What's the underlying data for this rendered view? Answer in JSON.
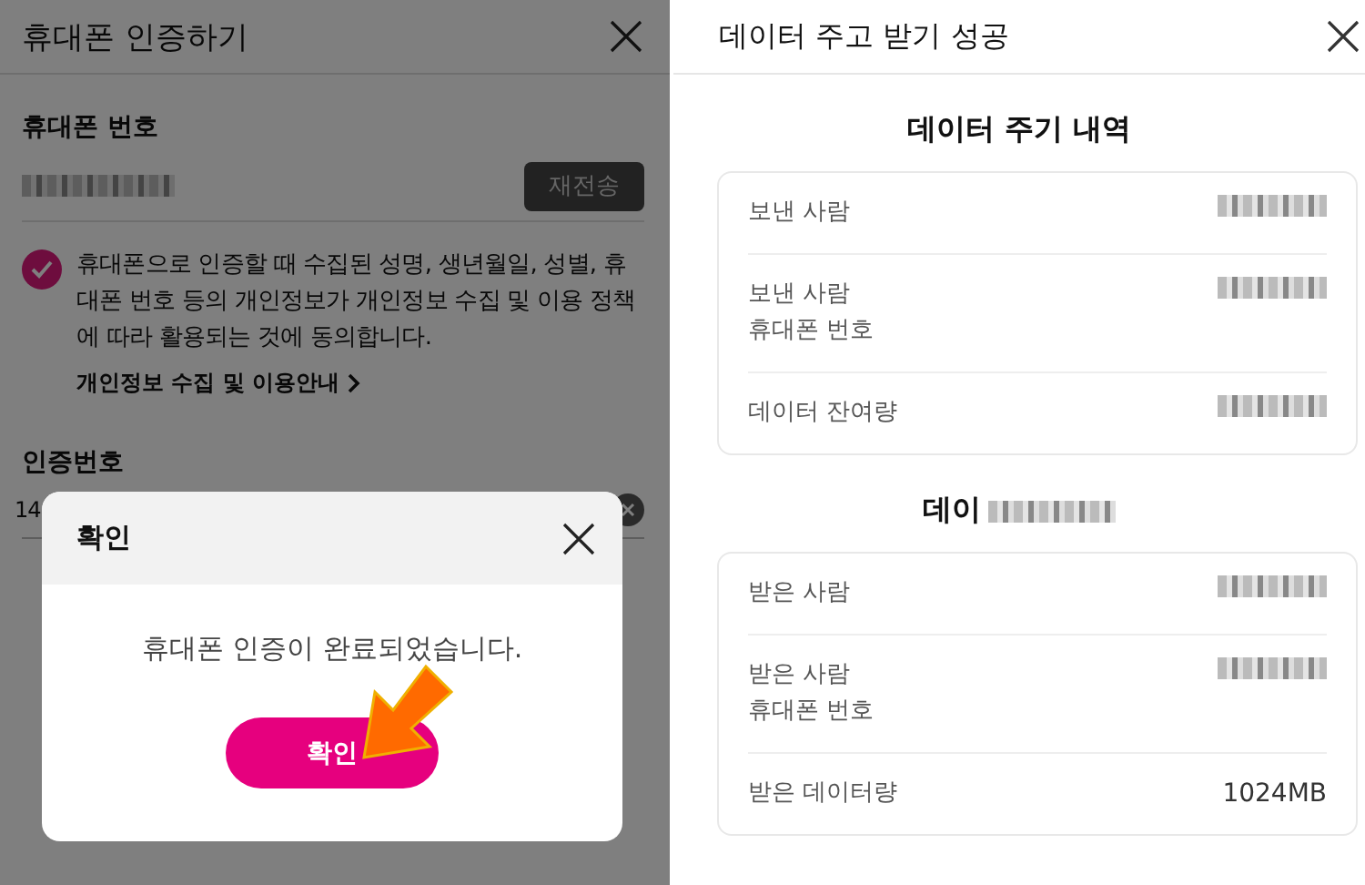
{
  "left_screen": {
    "title": "휴대폰 인증하기",
    "phone_section": {
      "label": "휴대폰 번호",
      "resend_button": "재전송"
    },
    "consent": {
      "checked": true,
      "text": "휴대폰으로 인증할 때 수집된 성명, 생년월일, 성별, 휴대폰 번호 등의 개인정보가 개인정보 수집 및 이용 정책에 따라 활용되는 것에 동의합니다.",
      "link": "개인정보 수집 및 이용안내"
    },
    "code_section": {
      "label": "인증번호",
      "value": "14"
    }
  },
  "dialog": {
    "title": "확인",
    "message": "휴대폰 인증이 완료되었습니다.",
    "confirm_button": "확인"
  },
  "right_screen": {
    "title": "데이터 주고 받기 성공",
    "sections": [
      {
        "heading": "데이터 주기 내역",
        "heading_cut": false,
        "rows": [
          {
            "label": "보낸 사람"
          },
          {
            "label": "보낸 사람\n휴대폰 번호"
          },
          {
            "label": "데이터 잔여량"
          }
        ]
      },
      {
        "heading": "데이",
        "heading_cut": true,
        "rows": [
          {
            "label": "받은 사람"
          },
          {
            "label": "받은 사람\n휴대폰 번호"
          },
          {
            "label": "받은 데이터량",
            "value": "1024MB"
          }
        ]
      }
    ]
  }
}
